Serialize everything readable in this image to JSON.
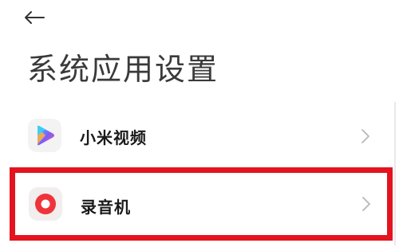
{
  "header": {
    "back_icon": "arrow-left-icon",
    "title": "系统应用设置"
  },
  "apps": [
    {
      "label": "小米视频",
      "icon": "mi-video-play-icon"
    },
    {
      "label": "录音机",
      "icon": "recorder-icon",
      "highlighted": true,
      "highlight_color": "#e3141f"
    }
  ],
  "colors": {
    "recorder_red": "#f0333b",
    "video_gradient": [
      "#3ec8ff",
      "#7b5cff",
      "#ff4f8b"
    ]
  }
}
